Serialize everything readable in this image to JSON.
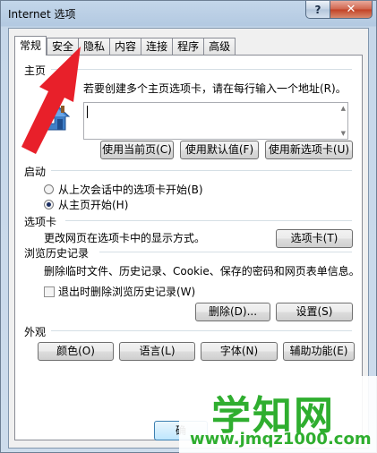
{
  "window": {
    "title": "Internet 选项",
    "help_label": "?",
    "close_label": "✕"
  },
  "tabs": [
    {
      "label": "常规",
      "active": true
    },
    {
      "label": "安全",
      "active": false
    },
    {
      "label": "隐私",
      "active": false
    },
    {
      "label": "内容",
      "active": false
    },
    {
      "label": "连接",
      "active": false
    },
    {
      "label": "程序",
      "active": false
    },
    {
      "label": "高级",
      "active": false
    }
  ],
  "homepage": {
    "section_label": "主页",
    "description": "若要创建多个主页选项卡，请在每行输入一个地址(R)。",
    "url_value": "",
    "use_current_label": "使用当前页(C)",
    "use_default_label": "使用默认值(F)",
    "use_new_tab_label": "使用新选项卡(U)"
  },
  "startup": {
    "section_label": "启动",
    "option_last_session": "从上次会话中的选项卡开始(B)",
    "option_homepage": "从主页开始(H)",
    "selected": "option_homepage"
  },
  "tab_settings": {
    "section_label": "选项卡",
    "description": "更改网页在选项卡中的显示方式。",
    "tabs_button_label": "选项卡(T)"
  },
  "history": {
    "section_label": "浏览历史记录",
    "description": "删除临时文件、历史记录、Cookie、保存的密码和网页表单信息。",
    "delete_on_exit_label": "退出时删除浏览历史记录(W)",
    "delete_on_exit_checked": false,
    "delete_button_label": "删除(D)...",
    "settings_button_label": "设置(S)"
  },
  "appearance": {
    "section_label": "外观",
    "colors_label": "颜色(O)",
    "languages_label": "语言(L)",
    "fonts_label": "字体(N)",
    "accessibility_label": "辅助功能(E)"
  },
  "footer": {
    "ok_peek": "确"
  },
  "watermark": {
    "title": "学知网",
    "url": "www.jmqz1000.com"
  },
  "colors": {
    "arrow": "#e8202a",
    "watermark": "#2fae2f"
  }
}
